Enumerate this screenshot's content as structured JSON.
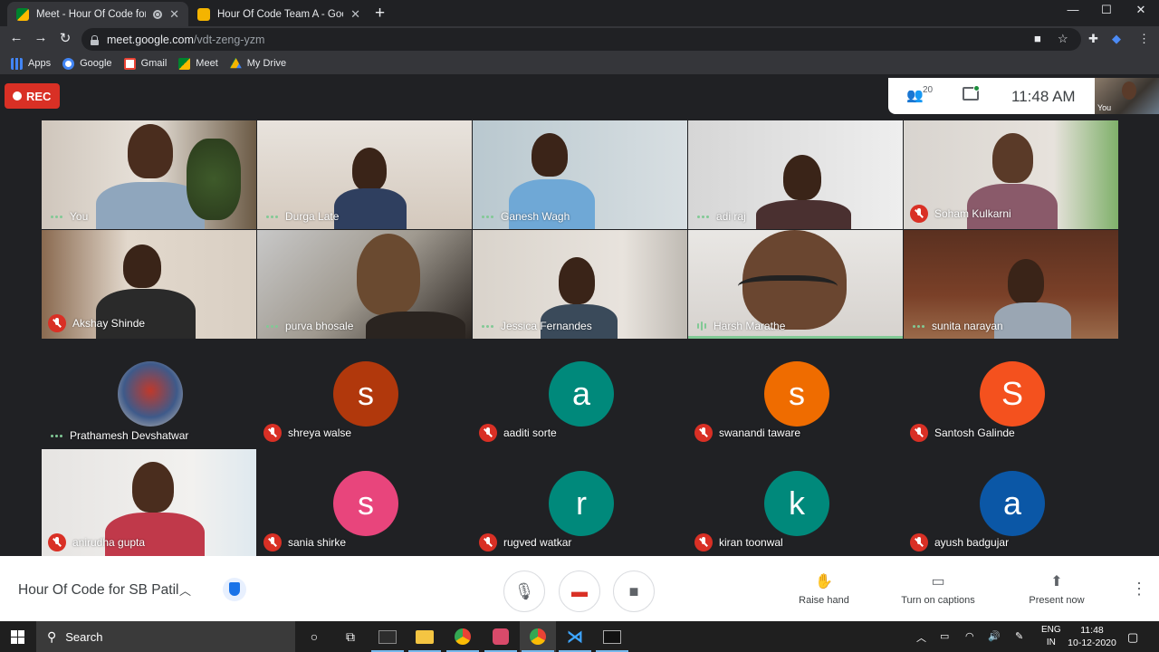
{
  "browser": {
    "tabs": [
      {
        "title": "Meet - Hour Of Code for SB",
        "active": true
      },
      {
        "title": "Hour Of Code Team A - Google S",
        "active": false
      }
    ],
    "new_tab": "+",
    "url_host": "meet.google.com",
    "url_path": "/vdt-zeng-yzm",
    "bookmarks": [
      "Apps",
      "Google",
      "Gmail",
      "Meet",
      "My Drive"
    ]
  },
  "meet": {
    "rec_label": "REC",
    "participants_count": "20",
    "time": "11:48  AM",
    "self_label": "You",
    "tiles": [
      {
        "name": "You",
        "status": "dots"
      },
      {
        "name": "Durga Late",
        "status": "dots"
      },
      {
        "name": "Ganesh Wagh",
        "status": "dots"
      },
      {
        "name": "adi raj",
        "status": "dots"
      },
      {
        "name": "Soham Kulkarni",
        "status": "muted"
      },
      {
        "name": "Akshay Shinde",
        "status": "muted"
      },
      {
        "name": "purva bhosale",
        "status": "dots"
      },
      {
        "name": "Jessica Fernandes",
        "status": "dots"
      },
      {
        "name": "Harsh Marathe",
        "status": "speaking"
      },
      {
        "name": "sunita narayan",
        "status": "dots"
      },
      {
        "name": "Prathamesh Devshatwar",
        "status": "dots"
      },
      {
        "name": "shreya walse",
        "status": "muted",
        "initial": "s"
      },
      {
        "name": "aaditi sorte",
        "status": "muted",
        "initial": "a"
      },
      {
        "name": "swanandi taware",
        "status": "muted",
        "initial": "s"
      },
      {
        "name": "Santosh Galinde",
        "status": "muted",
        "initial": "S"
      },
      {
        "name": "anirudha gupta",
        "status": "muted"
      },
      {
        "name": "sania shirke",
        "status": "muted",
        "initial": "s"
      },
      {
        "name": "rugved watkar",
        "status": "muted",
        "initial": "r"
      },
      {
        "name": "kiran toonwal",
        "status": "muted",
        "initial": "k"
      },
      {
        "name": "ayush badgujar",
        "status": "muted",
        "initial": "a"
      }
    ],
    "colors": {
      "rec": "#d93025",
      "avatar_brownred": "#b1380c",
      "avatar_teal": "#00897b",
      "avatar_orange": "#ef6c00",
      "avatar_deeporange": "#f4511e",
      "avatar_pink": "#e8457c",
      "avatar_blue": "#0b57a6",
      "speaking": "#81c995"
    }
  },
  "bottom_bar": {
    "meeting_title": "Hour Of Code for SB Patil",
    "actions": [
      "Raise hand",
      "Turn on captions",
      "Present now"
    ]
  },
  "taskbar": {
    "search_placeholder": "Search",
    "lang_line1": "ENG",
    "lang_line2": "IN",
    "time": "11:48",
    "date": "10-12-2020"
  }
}
